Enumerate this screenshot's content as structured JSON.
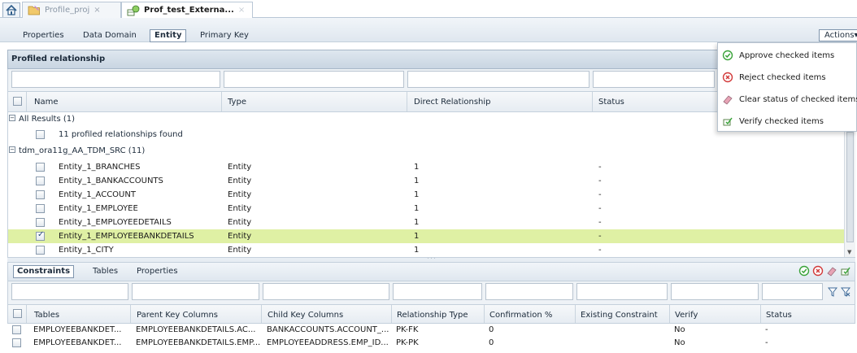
{
  "editor_tabs": [
    {
      "label": "Profile_proj"
    },
    {
      "label": "Prof_test_Externa..."
    }
  ],
  "subtabs": [
    "Properties",
    "Data Domain",
    "Entity",
    "Primary Key"
  ],
  "actions_label": "Actions",
  "actions_menu": [
    {
      "label": "Approve checked items",
      "icon": "approve-icon"
    },
    {
      "label": "Reject checked items",
      "icon": "reject-icon"
    },
    {
      "label": "Clear status of checked items",
      "icon": "eraser-icon"
    },
    {
      "label": "Verify checked items",
      "icon": "verify-icon"
    }
  ],
  "upper": {
    "title": "Profiled relationship",
    "columns": [
      "Name",
      "Type",
      "Direct Relationship",
      "Status"
    ],
    "group_all": "All Results (1)",
    "found_text": "11 profiled relationships found",
    "group_src": "tdm_ora11g_AA_TDM_SRC (11)",
    "rows": [
      {
        "name": "Entity_1_BRANCHES",
        "type": "Entity",
        "direct": "1",
        "status": "-",
        "checked": false
      },
      {
        "name": "Entity_1_BANKACCOUNTS",
        "type": "Entity",
        "direct": "1",
        "status": "-",
        "checked": false
      },
      {
        "name": "Entity_1_ACCOUNT",
        "type": "Entity",
        "direct": "1",
        "status": "-",
        "checked": false
      },
      {
        "name": "Entity_1_EMPLOYEE",
        "type": "Entity",
        "direct": "1",
        "status": "-",
        "checked": false
      },
      {
        "name": "Entity_1_EMPLOYEEDETAILS",
        "type": "Entity",
        "direct": "1",
        "status": "-",
        "checked": false
      },
      {
        "name": "Entity_1_EMPLOYEEBANKDETAILS",
        "type": "Entity",
        "direct": "1",
        "status": "-",
        "checked": true
      },
      {
        "name": "Entity_1_CITY",
        "type": "Entity",
        "direct": "1",
        "status": "-",
        "checked": false
      }
    ]
  },
  "lower": {
    "tabs": [
      "Constraints",
      "Tables",
      "Properties"
    ],
    "columns": [
      "Tables",
      "Parent Key Columns",
      "Child Key Columns",
      "Relationship Type",
      "Confirmation %",
      "Existing Constraint",
      "Verify",
      "Status"
    ],
    "rows": [
      [
        "EMPLOYEEBANKDET...",
        "EMPLOYEEBANKDETAILS.AC...",
        "BANKACCOUNTS.ACCOUNT_...",
        "PK-FK",
        "0",
        "",
        "No",
        "-"
      ],
      [
        "EMPLOYEEBANKDET...",
        "EMPLOYEEBANKDETAILS.EMP...",
        "EMPLOYEEADDRESS.EMP_ID...",
        "PK-PK",
        "0",
        "",
        "No",
        "-"
      ]
    ]
  },
  "colors": {
    "selected_row": "#dff0a4",
    "approve": "#3aa33a",
    "reject": "#d23a3a"
  }
}
